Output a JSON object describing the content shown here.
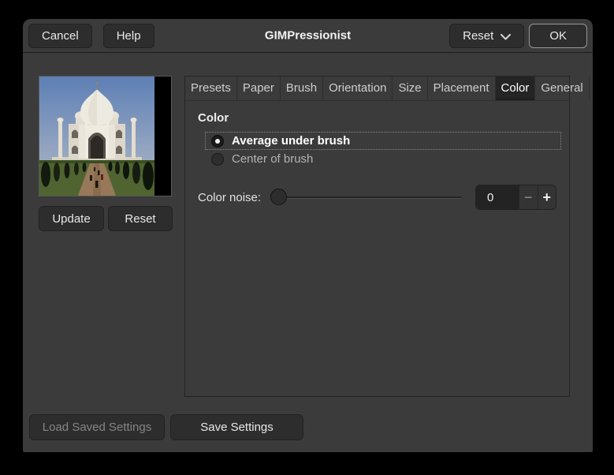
{
  "window": {
    "title": "GIMPressionist"
  },
  "titlebar": {
    "cancel_label": "Cancel",
    "help_label": "Help",
    "reset_label": "Reset",
    "ok_label": "OK"
  },
  "preview": {
    "update_label": "Update",
    "reset_label": "Reset"
  },
  "tabs": {
    "selected": "Color",
    "items": [
      {
        "label": "Presets"
      },
      {
        "label": "Paper"
      },
      {
        "label": "Brush"
      },
      {
        "label": "Orientation"
      },
      {
        "label": "Size"
      },
      {
        "label": "Placement"
      },
      {
        "label": "Color"
      },
      {
        "label": "General"
      }
    ]
  },
  "color_panel": {
    "heading": "Color",
    "options": [
      {
        "label": "Average under brush",
        "selected": true
      },
      {
        "label": "Center of brush",
        "selected": false
      }
    ],
    "noise": {
      "label": "Color noise:",
      "value": "0",
      "decrement_glyph": "−",
      "increment_glyph": "+"
    }
  },
  "footer": {
    "load_label": "Load Saved Settings",
    "load_enabled": false,
    "save_label": "Save Settings"
  },
  "colors": {
    "dialog_bg": "#3b3b3b",
    "button_bg": "#2d2d2d",
    "selected_tab_bg": "#242424",
    "entry_bg": "#232323",
    "text": "#eeeeee",
    "dim_text": "#848484",
    "default_button_border": "#989898"
  }
}
